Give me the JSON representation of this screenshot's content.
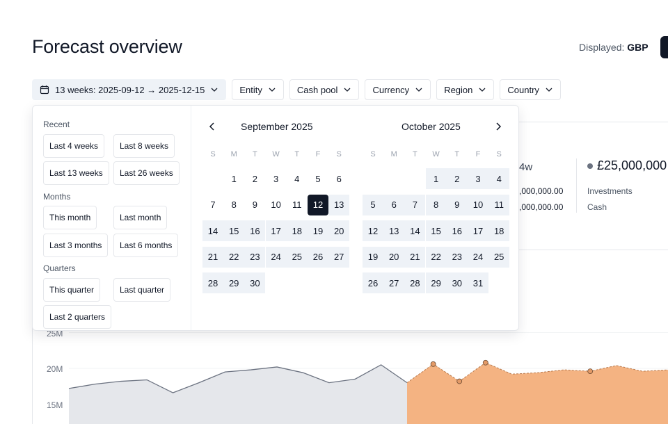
{
  "header": {
    "title": "Forecast overview",
    "displayed_label": "Displayed:",
    "displayed_value": "GBP"
  },
  "filters": {
    "date_range": "13 weeks: 2025-09-12 → 2025-12-15",
    "entity": "Entity",
    "cash_pool": "Cash pool",
    "currency": "Currency",
    "region": "Region",
    "country": "Country"
  },
  "background": {
    "period": "4w",
    "value1": ",000,000.00",
    "value2": ",000,000.00",
    "big_value": "£25,000,000",
    "investments": "Investments",
    "cash": "Cash"
  },
  "chart_data": {
    "type": "area",
    "y_ticks": [
      "25M",
      "20M",
      "15M"
    ],
    "series": [
      {
        "values": [
          17.2,
          17.8,
          18.2,
          18.4,
          16.6,
          18.0,
          19.5,
          19.8,
          20.2,
          19.4,
          18.0,
          18.5,
          20.5,
          18.0
        ]
      },
      {
        "values": [
          18.0,
          20.6,
          18.2,
          20.8,
          19.2,
          19.4,
          19.8,
          19.6,
          20.4,
          19.6,
          19.8
        ]
      }
    ],
    "colors": {
      "actual": "#e5e7eb",
      "forecast": "#f4b382"
    }
  },
  "popover": {
    "presets": {
      "recent_title": "Recent",
      "last_4_weeks": "Last 4 weeks",
      "last_8_weeks": "Last 8 weeks",
      "last_13_weeks": "Last 13 weeks",
      "last_26_weeks": "Last 26 weeks",
      "months_title": "Months",
      "this_month": "This month",
      "last_month": "Last month",
      "last_3_months": "Last 3 months",
      "last_6_months": "Last 6 months",
      "quarters_title": "Quarters",
      "this_quarter": "This quarter",
      "last_quarter": "Last quarter",
      "last_2_quarters": "Last 2 quarters"
    },
    "calendar": {
      "dow": [
        "S",
        "M",
        "T",
        "W",
        "T",
        "F",
        "S"
      ],
      "months": [
        {
          "title": "September 2025",
          "start_weekday": 1,
          "days": 30,
          "range_from": 12
        },
        {
          "title": "October 2025",
          "start_weekday": 3,
          "days": 31,
          "range_from": 1
        }
      ]
    }
  }
}
